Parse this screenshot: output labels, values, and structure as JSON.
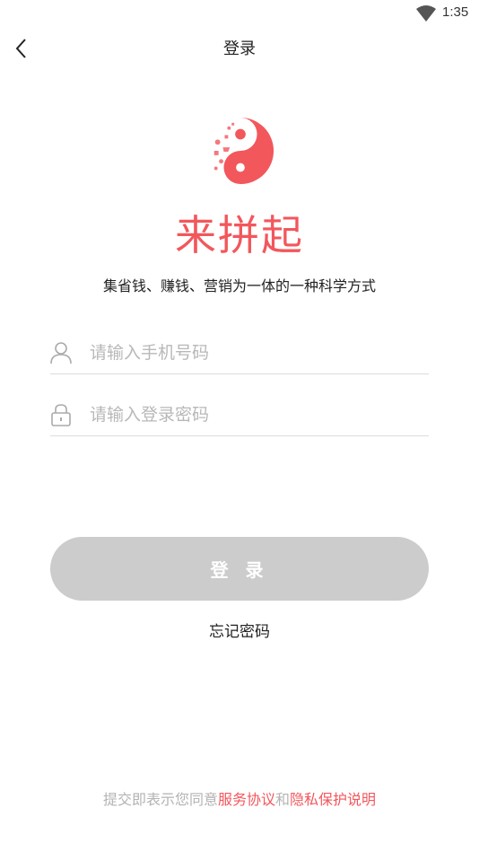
{
  "status_bar": {
    "time": "1:35"
  },
  "header": {
    "title": "登录"
  },
  "brand": {
    "name": "来拼起",
    "slogan": "集省钱、赚钱、营销为一体的一种科学方式"
  },
  "form": {
    "phone_placeholder": "请输入手机号码",
    "password_placeholder": "请输入登录密码",
    "login_label": "登 录",
    "forgot_label": "忘记密码"
  },
  "agreement": {
    "prefix": "提交即表示您同意",
    "service_link": "服务协议",
    "conjunction": "和",
    "privacy_link": "隐私保护说明"
  },
  "colors": {
    "accent": "#f2575c",
    "button_disabled": "#cccccc",
    "placeholder": "#b8b8b8"
  }
}
